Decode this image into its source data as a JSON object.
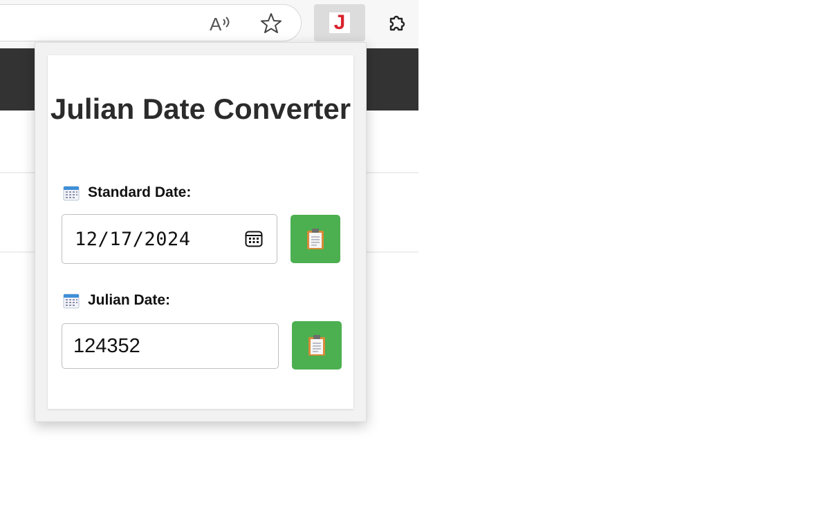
{
  "browser": {
    "toolbar_icons": [
      "read-aloud-icon",
      "favorite-star-icon",
      "extensions-puzzle-icon"
    ],
    "extension_button": {
      "letter": "J",
      "icon": "julian-extension-icon",
      "color": "#d9232d"
    }
  },
  "popup": {
    "title": "Julian Date Converter",
    "standard": {
      "label": "Standard Date:",
      "icon": "calendar-icon",
      "value": "12/17/2024",
      "picker_icon": "calendar-picker-icon",
      "copy_icon": "clipboard-icon"
    },
    "julian": {
      "label": "Julian Date:",
      "icon": "calendar-icon",
      "value": "124352",
      "copy_icon": "clipboard-icon"
    }
  },
  "colors": {
    "accent": "#4caf50",
    "page_header": "#333333",
    "title_text": "#2b2b2b",
    "ext_logo": "#d9232d"
  }
}
